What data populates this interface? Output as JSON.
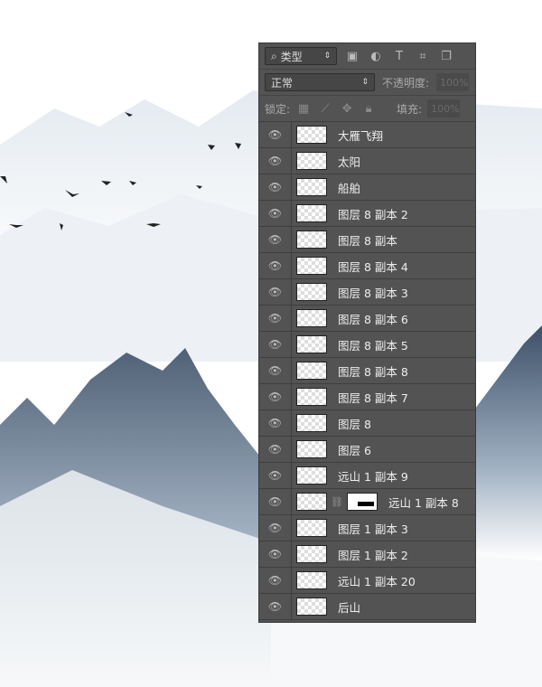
{
  "toolbar": {
    "filter_kind": "类型",
    "filter_icons": [
      "image-filter-icon",
      "adjustment-filter-icon",
      "type-filter-icon",
      "shape-filter-icon",
      "smart-object-filter-icon"
    ]
  },
  "blend": {
    "mode": "正常",
    "opacity_label": "不透明度:",
    "opacity_value": "100%"
  },
  "lock": {
    "label": "锁定:",
    "fill_label": "填充:",
    "fill_value": "100%"
  },
  "layers": [
    {
      "name": "大雁飞翔"
    },
    {
      "name": "太阳"
    },
    {
      "name": "船舶"
    },
    {
      "name": "图层 8 副本 2"
    },
    {
      "name": "图层 8 副本"
    },
    {
      "name": "图层 8 副本 4"
    },
    {
      "name": "图层 8 副本 3"
    },
    {
      "name": "图层 8 副本 6"
    },
    {
      "name": "图层 8 副本 5"
    },
    {
      "name": "图层 8 副本 8"
    },
    {
      "name": "图层 8 副本 7"
    },
    {
      "name": "图层 8"
    },
    {
      "name": "图层 6"
    },
    {
      "name": "远山 1 副本 9"
    },
    {
      "name": "远山 1 副本 8",
      "mask": true
    },
    {
      "name": "图层 1 副本 3"
    },
    {
      "name": "图层 1 副本 2"
    },
    {
      "name": "远山 1 副本 20"
    },
    {
      "name": "后山"
    }
  ],
  "colors": {
    "panel": "#535353",
    "mountain": "#3d5068"
  }
}
